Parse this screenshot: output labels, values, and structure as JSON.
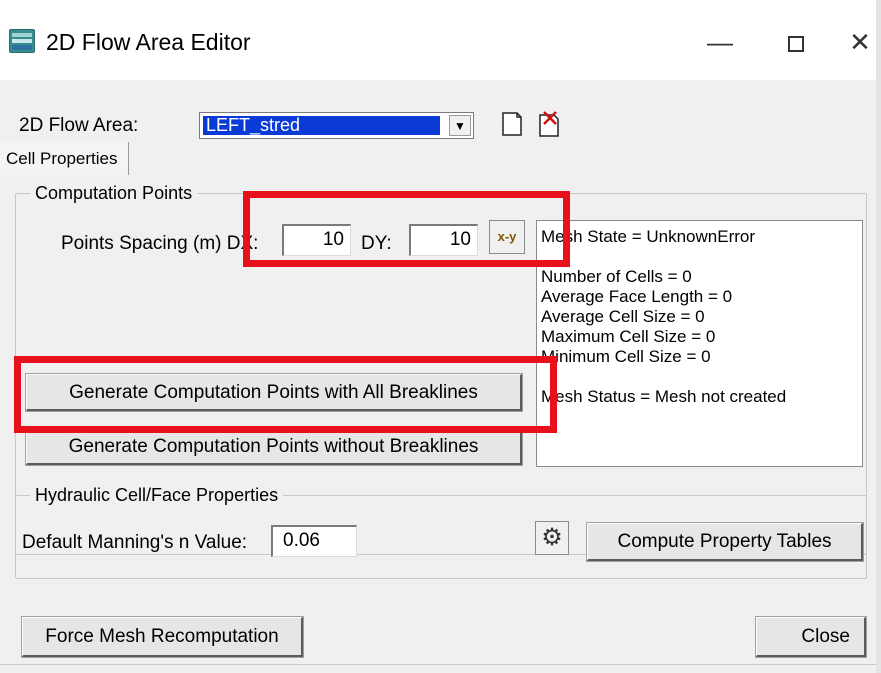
{
  "window": {
    "title": "2D Flow Area Editor",
    "minimize": "—",
    "close": "✕"
  },
  "flow_area": {
    "label": "2D Flow Area:",
    "selected": "LEFT_stred"
  },
  "tabs": [
    "Cell Properties"
  ],
  "computation_points": {
    "group_title": "Computation Points",
    "spacing_label": "Points Spacing (m) DX:",
    "dx_value": "10",
    "dy_label": "DY:",
    "dy_value": "10",
    "xy_button": "x-y",
    "generate_all_button": "Generate Computation Points with All Breaklines",
    "generate_without_button": "Generate Computation Points without Breaklines"
  },
  "mesh_status": {
    "state": "Mesh State = UnknownError",
    "num_cells": "Number of Cells = 0",
    "avg_face": "Average Face Length = 0",
    "avg_cell": "Average Cell Size = 0",
    "max_cell": "Maximum Cell Size = 0",
    "min_cell": "Minimum Cell Size = 0",
    "status": "Mesh Status = Mesh not created"
  },
  "hydraulic": {
    "group_title": "Hydraulic Cell/Face Properties",
    "manning_label": "Default Manning's n Value:",
    "manning_value": "0.06",
    "compute_button": "Compute Property Tables"
  },
  "footer": {
    "force_button": "Force Mesh Recomputation",
    "close_button": "Close"
  },
  "colors": {
    "highlight": "#e8101a",
    "selection": "#0a3bd6"
  }
}
